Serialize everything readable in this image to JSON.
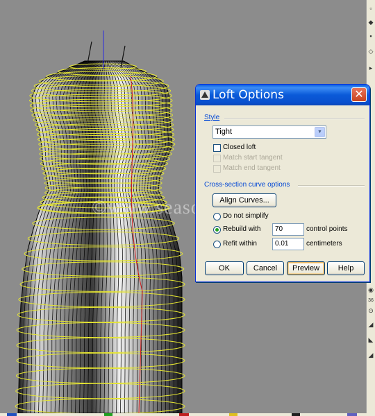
{
  "watermark": "©www.season.ru",
  "dialog": {
    "title": "Loft Options",
    "close_label": "✕",
    "style_section": {
      "label": "Style",
      "selected": "Tight",
      "closed_loft": "Closed loft",
      "closed_loft_checked": false,
      "match_start_tangent": "Match start tangent",
      "match_end_tangent": "Match end tangent"
    },
    "cross_section": {
      "label": "Cross-section curve options",
      "align_curves": "Align Curves...",
      "do_not_simplify": "Do not simplify",
      "rebuild_with": "Rebuild with",
      "rebuild_value": "70",
      "rebuild_unit": "control points",
      "refit_within": "Refit within",
      "refit_value": "0.01",
      "refit_unit": "centimeters",
      "selected_option": "rebuild_with"
    },
    "buttons": {
      "ok": "OK",
      "cancel": "Cancel",
      "preview": "Preview",
      "help": "Help"
    }
  },
  "toolbar": {
    "label": "36"
  },
  "colors": {
    "curve": "#e6e632",
    "axis_blue": "#2a2ae0",
    "axis_red": "#d02020",
    "title_bar": "#0a5ad8"
  }
}
